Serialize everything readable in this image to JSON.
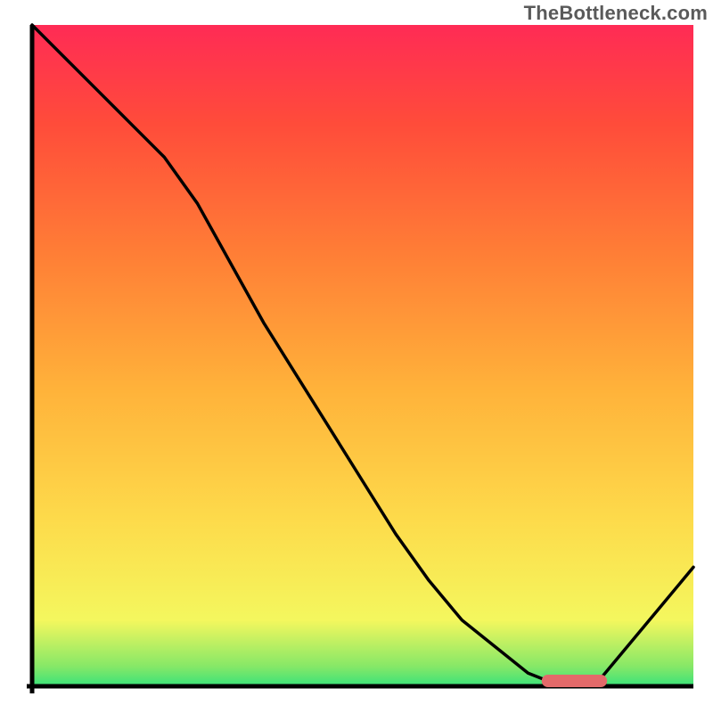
{
  "watermark": "TheBottleneck.com",
  "chart_data": {
    "type": "line",
    "title": "",
    "xlabel": "",
    "ylabel": "",
    "xlim": [
      0,
      100
    ],
    "ylim": [
      0,
      100
    ],
    "note": "Bottleneck-style chart: a gradient field from red (top, large mismatch) through orange/yellow to green (bottom, optimal). The black curve plots deviation from optimal; the minimum denotes the sweet spot, marked by a short red bar at y≈0.",
    "x": [
      0,
      5,
      10,
      15,
      20,
      25,
      30,
      35,
      40,
      45,
      50,
      55,
      60,
      65,
      70,
      75,
      80,
      82,
      85,
      90,
      95,
      100
    ],
    "values": [
      100,
      95,
      90,
      85,
      80,
      73,
      64,
      55,
      47,
      39,
      31,
      23,
      16,
      10,
      6,
      2,
      0,
      0,
      0,
      6,
      12,
      18
    ],
    "optimal_marker": {
      "x_start": 78,
      "x_end": 86,
      "y": 0
    },
    "gradient_stops": [
      {
        "pct": 0,
        "hex": "#39e27a"
      },
      {
        "pct": 3,
        "hex": "#86e867"
      },
      {
        "pct": 10,
        "hex": "#f4f75e"
      },
      {
        "pct": 25,
        "hex": "#fddb4b"
      },
      {
        "pct": 45,
        "hex": "#ffb23a"
      },
      {
        "pct": 65,
        "hex": "#ff7f36"
      },
      {
        "pct": 85,
        "hex": "#ff4c3a"
      },
      {
        "pct": 100,
        "hex": "#ff2b55"
      }
    ]
  }
}
